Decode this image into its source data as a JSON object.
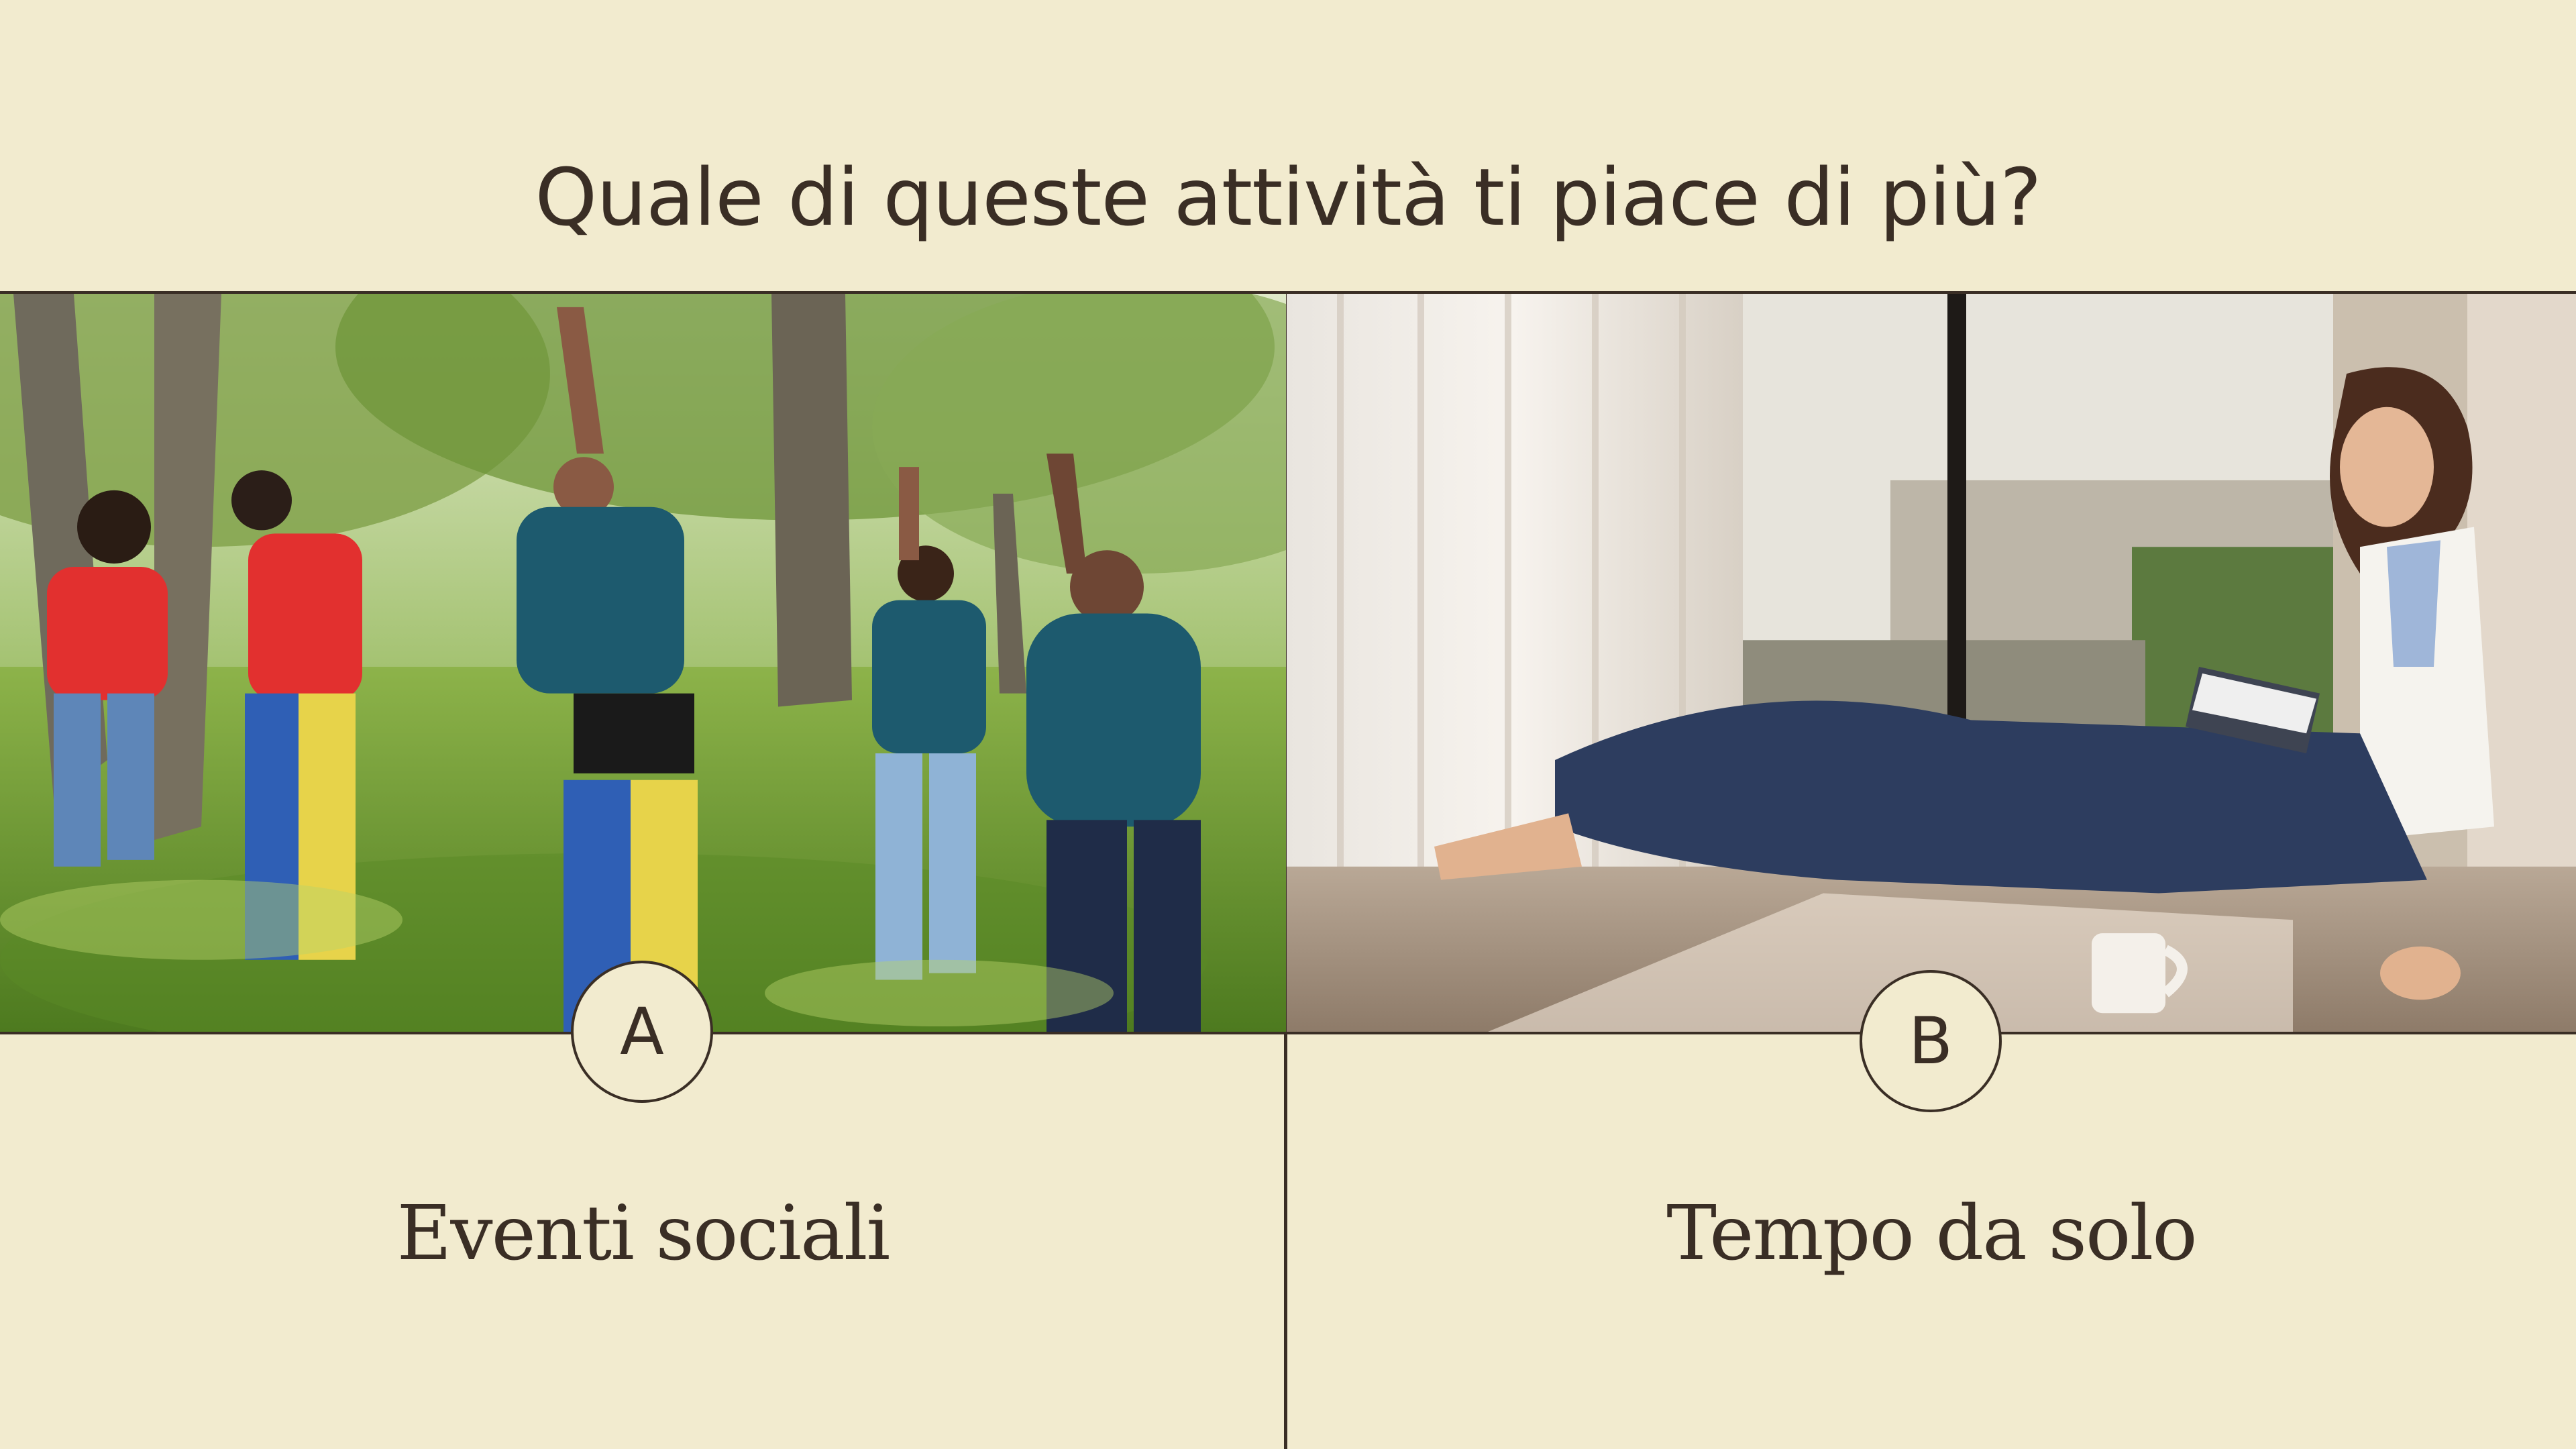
{
  "question": {
    "title": "Quale di queste attività ti piace di più?"
  },
  "options": [
    {
      "letter": "A",
      "label": "Eventi sociali",
      "photo": "group-of-people-in-park-sack-race"
    },
    {
      "letter": "B",
      "label": "Tempo da solo",
      "photo": "woman-reading-book-on-floor"
    }
  ],
  "colors": {
    "background": "#f2ebcf",
    "text": "#3a2e25",
    "line": "#3a2e25"
  }
}
